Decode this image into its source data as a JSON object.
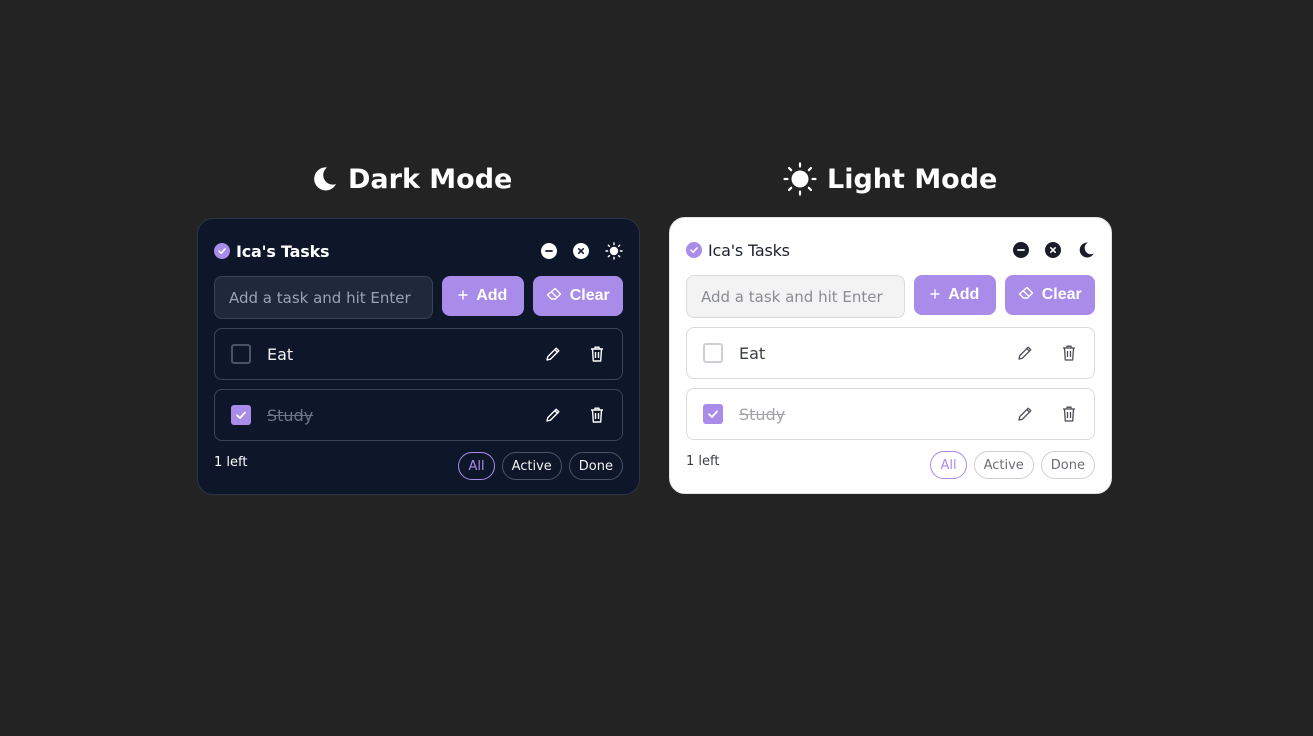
{
  "headings": {
    "dark": "Dark Mode",
    "light": "Light Mode"
  },
  "colors": {
    "accent": "#a98bea",
    "page_bg": "#232323",
    "dark_card": "#0e172a",
    "light_card": "#ffffff"
  },
  "dark_panel": {
    "title": "Ica's Tasks",
    "input_placeholder": "Add a task and hit Enter",
    "add_label": "Add",
    "clear_label": "Clear",
    "tasks": [
      {
        "label": "Eat",
        "done": false
      },
      {
        "label": "Study",
        "done": true
      }
    ],
    "left_text": "1 left",
    "filters": [
      "All",
      "Active",
      "Done"
    ]
  },
  "light_panel": {
    "title": "Ica's Tasks",
    "input_placeholder": "Add a task and hit Enter",
    "add_label": "Add",
    "clear_label": "Clear",
    "tasks": [
      {
        "label": "Eat",
        "done": false
      },
      {
        "label": "Study",
        "done": true
      }
    ],
    "left_text": "1 left",
    "filters": [
      "All",
      "Active",
      "Done"
    ]
  }
}
